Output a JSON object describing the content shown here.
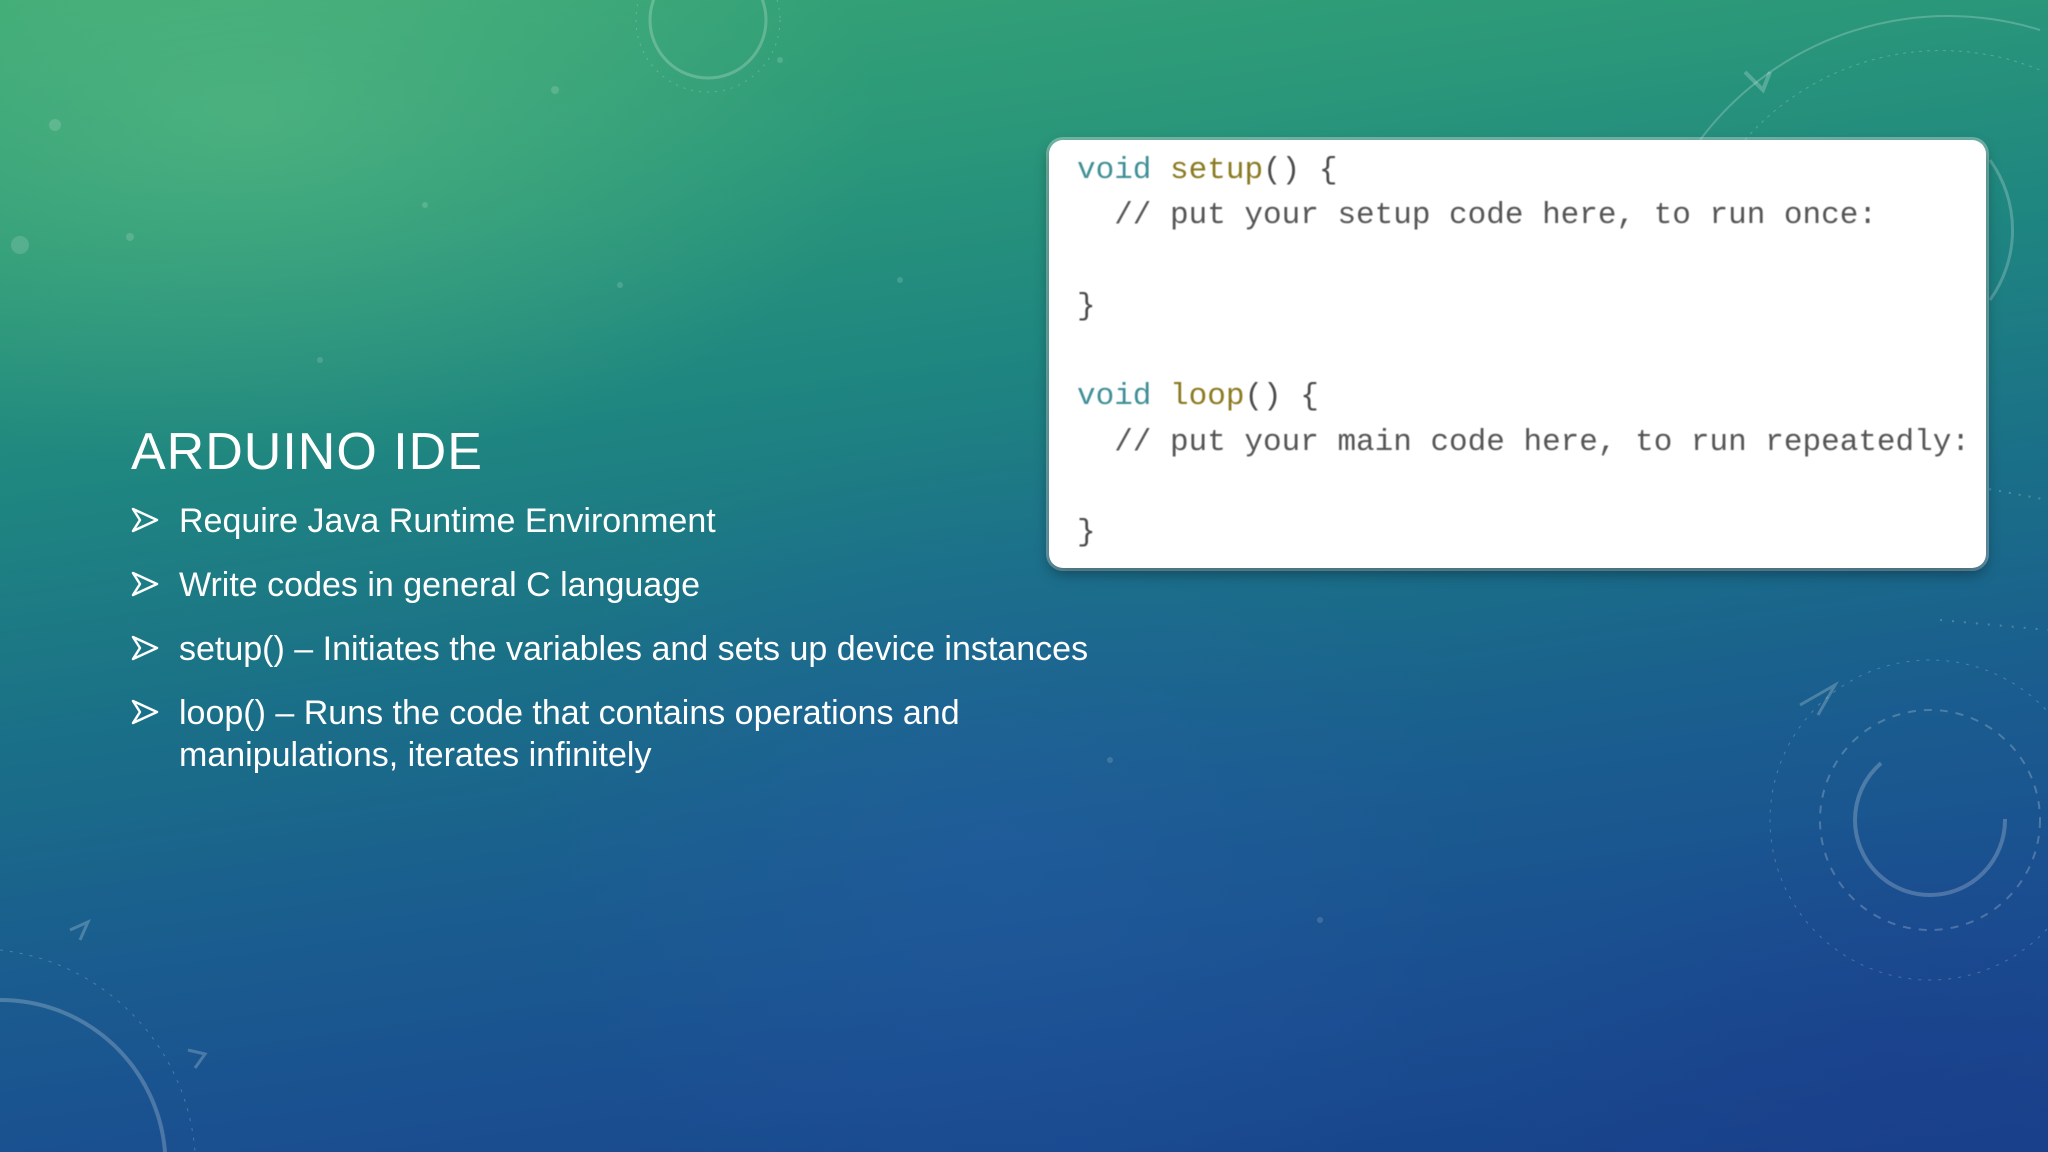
{
  "slide": {
    "title": "ARDUINO IDE",
    "bullets": [
      {
        "text": "Require Java Runtime Environment"
      },
      {
        "text": "Write codes in general C language"
      },
      {
        "text": "setup() – Initiates the variables and sets up device instances"
      },
      {
        "text": "loop() – Runs the code that contains operations and manipulations, iterates infinitely"
      }
    ],
    "bullet_icon": "arrow-bullet-icon"
  },
  "code": {
    "setup_keyword": "void",
    "setup_name": "setup",
    "setup_parens": "() {",
    "setup_comment": "  // put your setup code here, to run once:",
    "setup_close": "}",
    "loop_keyword": "void",
    "loop_name": "loop",
    "loop_parens": "() {",
    "loop_comment": "  // put your main code here, to run repeatedly:",
    "loop_close": "}"
  },
  "colors": {
    "text": "#ffffff",
    "keyword": "#3f8f96",
    "function": "#8a7a20",
    "comment": "#555555"
  }
}
